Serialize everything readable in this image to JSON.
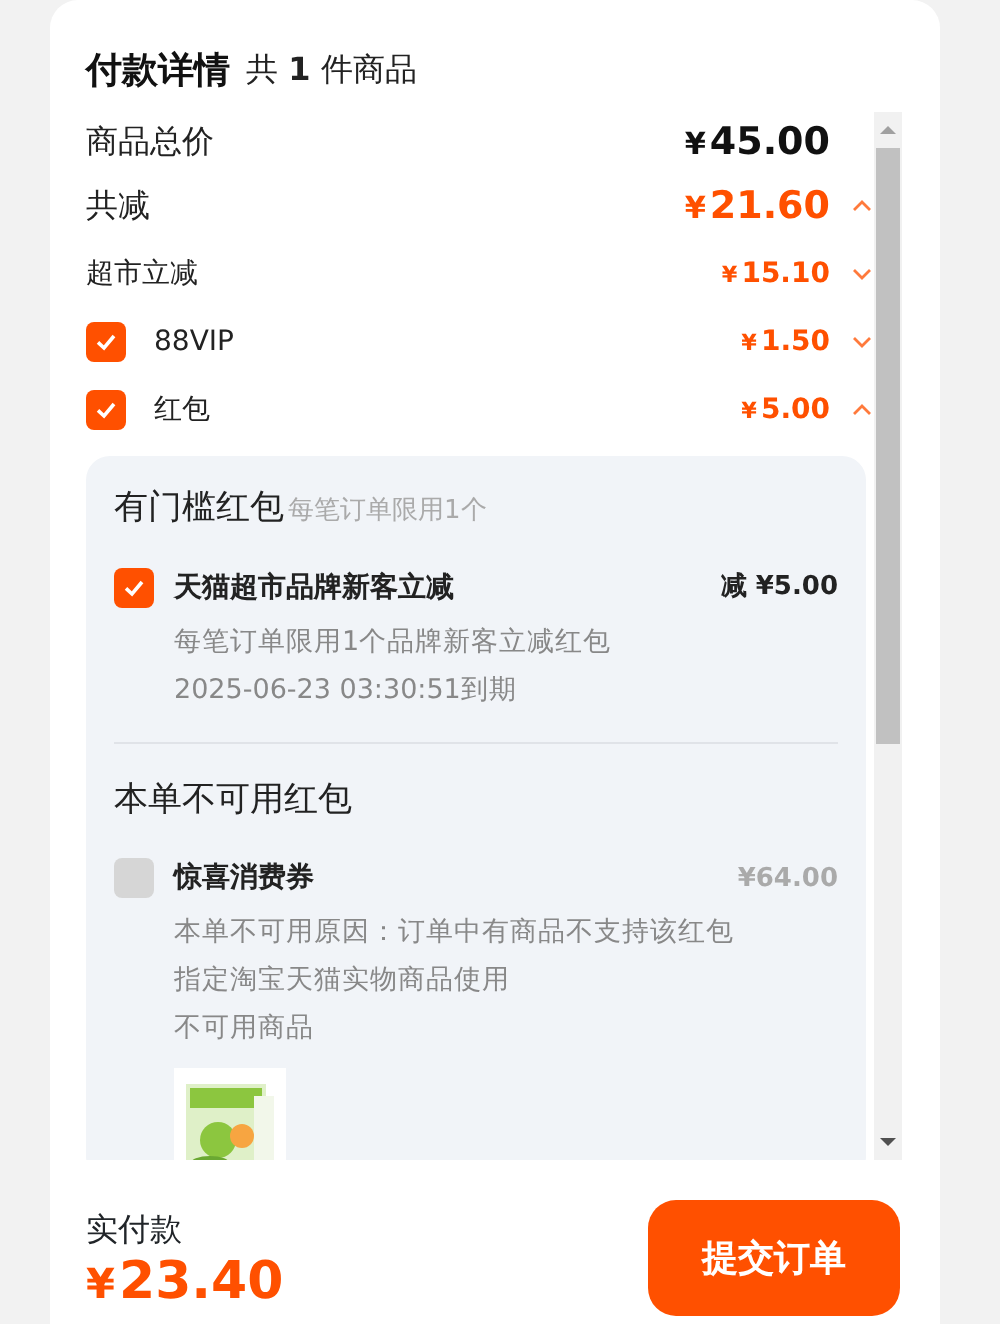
{
  "header": {
    "title": "付款详情",
    "count_text": "共 **1** 件商品"
  },
  "rows": [
    {
      "kind": "total",
      "label": "商品总价",
      "currency": "¥",
      "amount": "45.00"
    },
    {
      "kind": "discount",
      "label": "共减",
      "currency": "¥",
      "amount": "21.60",
      "expanded": true
    },
    {
      "kind": "plain",
      "label": "超市立减",
      "currency": "¥",
      "amount": "15.10",
      "expanded": false
    },
    {
      "kind": "check",
      "label": "88VIP",
      "checked": true,
      "currency": "¥",
      "amount": "1.50",
      "expanded": false
    },
    {
      "kind": "check",
      "label": "红包",
      "checked": true,
      "currency": "¥",
      "amount": "5.00",
      "expanded": true
    }
  ],
  "panel": {
    "sections": [
      {
        "title": "有门槛红包",
        "note": "每笔订单限用1个",
        "coupons": [
          {
            "name": "天猫超市品牌新客立减",
            "value": "减 ¥5.00",
            "checked": true,
            "disabled": false,
            "lines": [
              "每笔订单限用1个品牌新客立减红包",
              "2025-06-23 03:30:51到期"
            ]
          }
        ]
      },
      {
        "title": "本单不可用红包",
        "coupons": [
          {
            "name": "惊喜消费券",
            "value": "¥64.00",
            "checked": false,
            "disabled": true,
            "lines": [
              "本单不可用原因：订单中有商品不支持该红包",
              "指定淘宝天猫实物商品使用",
              "不可用商品"
            ]
          }
        ]
      }
    ]
  },
  "footer": {
    "label": "实付款",
    "currency": "¥",
    "amount": "23.40",
    "button": "提交订单"
  }
}
